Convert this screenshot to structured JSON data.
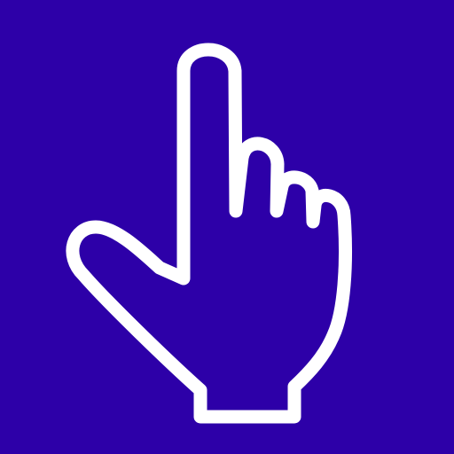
{
  "icon": {
    "name": "pointing-hand-icon",
    "background_color": "#2d00a8",
    "stroke_color": "#ffffff"
  }
}
